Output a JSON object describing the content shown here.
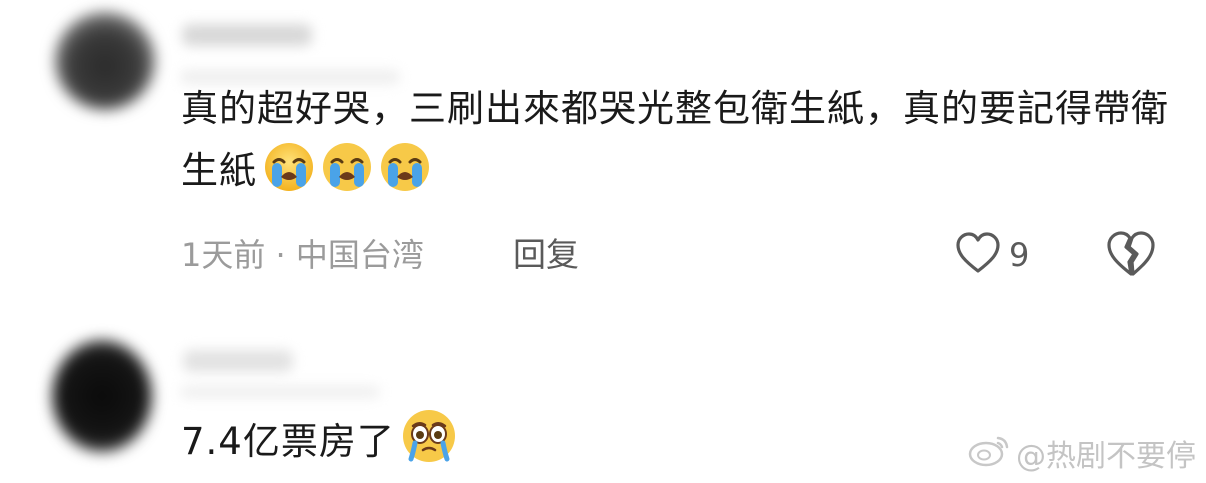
{
  "comments": [
    {
      "text": "真的超好哭，三刷出來都哭光整包衛生紙，真的要記得帶衛生紙",
      "emojis": [
        "loudly-crying-face",
        "loudly-crying-face",
        "loudly-crying-face"
      ],
      "meta": "1天前 · 中国台湾",
      "reply_label": "回复",
      "like_count": "9"
    },
    {
      "text": "7.4亿票房了",
      "emojis": [
        "holding-back-tears-face"
      ]
    }
  ],
  "watermark": {
    "text": "@热剧不要停"
  },
  "colors": {
    "text": "#1a1a1a",
    "meta": "#9b9b9b",
    "action": "#5a5a5a",
    "emoji_face": "#f7c948",
    "tears": "#4aa3e8"
  }
}
